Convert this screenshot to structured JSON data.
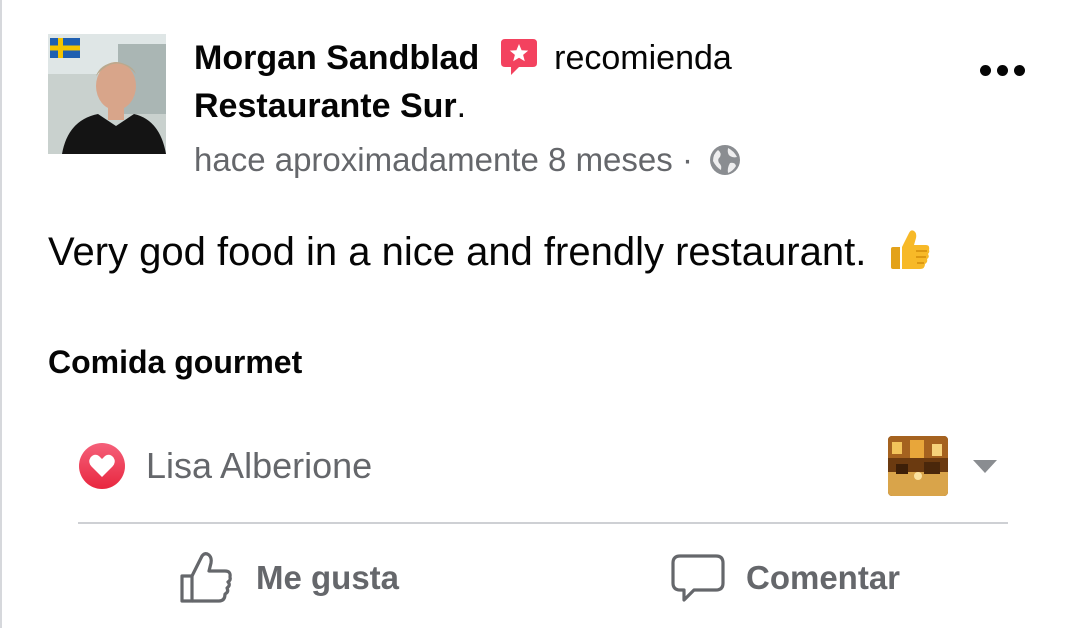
{
  "post": {
    "author": "Morgan Sandblad",
    "action_word": "recomienda",
    "place": "Restaurante Sur",
    "place_suffix": ".",
    "timestamp": "hace aproximadamente 8 meses",
    "separator": "·",
    "audience_icon": "globe-icon",
    "text": "Very god food in a nice and frendly restaurant.",
    "emoji": "thumbs-up-emoji",
    "tag": "Comida gourmet",
    "more_icon": "more-options-icon"
  },
  "reactions": {
    "type_icon": "heart-reaction-icon",
    "reactor_name": "Lisa Alberione",
    "dropdown_icon": "caret-down-icon"
  },
  "actions": {
    "like_label": "Me gusta",
    "comment_label": "Comentar"
  },
  "colors": {
    "text_primary": "#050505",
    "text_secondary": "#65676b",
    "recommend_badge": "#f3425f",
    "heart": "#f33e58",
    "divider": "#ced0d4",
    "thumb_emoji": "#f7b928"
  }
}
